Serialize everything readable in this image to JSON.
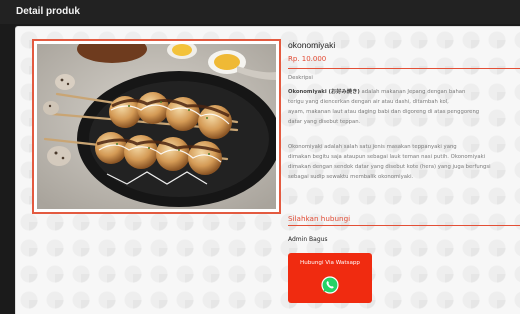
{
  "header": {
    "title": "Detail produk"
  },
  "product": {
    "name": "okonomiyaki",
    "price": "Rp. 10.000",
    "description_label": "Deskripsi",
    "description_paragraphs": [
      {
        "lead": "Okonomiyaki (お好み焼き)",
        "lines": [
          " adalah makanan Jepang dengan bahan",
          "terigu yang diencerkan dengan air atau dashi, ditambah kol,",
          "ayam, makanan laut atau daging babi dan digoreng di atas penggoreng",
          "datar yang disebut teppan."
        ]
      },
      {
        "lines": [
          "Okonomiyaki adalah salah satu jenis masakan teppanyaki yang",
          "dimakan begitu saja ataupun sebagai lauk teman nasi putih. Okonomiyaki",
          "dimakan dengan sendok datar yang disebut kote (hera) yang juga berfungsi",
          "sebagai sudip sewaktu membalik okonomiyaki."
        ]
      }
    ]
  },
  "contact": {
    "title": "Silahkan hubungi",
    "admin_name": "Admin Bagus",
    "button_label": "Hubungi Via Watsapp",
    "button_icon": "whatsapp-icon"
  },
  "colors": {
    "accent": "#e34f36",
    "button": "#f02b10",
    "whatsapp": "#25d366"
  }
}
